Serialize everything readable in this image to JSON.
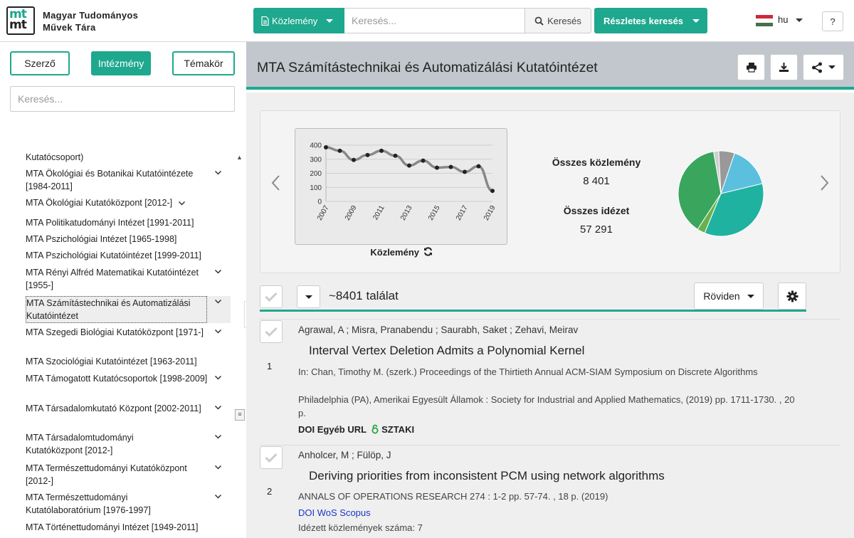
{
  "header": {
    "logo_text_top": "mt",
    "logo_text_bottom": "mt",
    "brand_line1": "Magyar Tudományos",
    "brand_line2": "Művek Tára",
    "type_button": "Közlemény",
    "search_placeholder": "Keresés...",
    "search_button": "Keresés",
    "advanced_button": "Részletes keresés",
    "language": "hu",
    "help": "?"
  },
  "sidebar": {
    "tabs": [
      "Szerző",
      "Intézmény",
      "Témakör"
    ],
    "active_tab": "Intézmény",
    "search_placeholder": "Keresés...",
    "items": [
      {
        "label": "Kutatócsoport)",
        "expandable": false
      },
      {
        "label": "MTA Ökológiai és Botanikai Kutatóintézete [1984-2011]",
        "expandable": true
      },
      {
        "label": "MTA Ökológiai Kutatóközpont [2012-]",
        "expandable": true
      },
      {
        "label": "MTA Politikatudományi Intézet [1991-2011]",
        "expandable": false
      },
      {
        "label": "MTA Pszichológiai Intézet [1965-1998]",
        "expandable": false
      },
      {
        "label": "MTA Pszichológiai Kutatóintézet [1999-2011]",
        "expandable": false
      },
      {
        "label": "MTA Rényi Alfréd Matematikai Kutatóintézet [1955-]",
        "expandable": true
      },
      {
        "label": "MTA Számítástechnikai és Automatizálási Kutatóintézet",
        "expandable": true,
        "selected": true
      },
      {
        "label": "MTA Szegedi Biológiai Kutatóközpont [1971-]",
        "expandable": true
      },
      {
        "label": "MTA Szociológiai Kutatóintézet [1963-2011]",
        "expandable": false
      },
      {
        "label": "MTA Támogatott Kutatócsoportok [1998-2009]",
        "expandable": true
      },
      {
        "label": "MTA Társadalomkutató Központ [2002-2011]",
        "expandable": true
      },
      {
        "label": "MTA Társadalomtudományi Kutatóközpont [2012-]",
        "expandable": true
      },
      {
        "label": "MTA Természettudományi Kutatóközpont [2012-]",
        "expandable": true
      },
      {
        "label": "MTA Természettudományi Kutatólaboratórium [1976-1997]",
        "expandable": true
      },
      {
        "label": "MTA Történettudományi Intézet [1949-2011]",
        "expandable": false
      }
    ]
  },
  "main": {
    "title": "MTA Számítástechnikai és Automatizálási Kutatóintézet",
    "stats": {
      "total_pubs_label": "Összes közlemény",
      "total_pubs": "8 401",
      "total_cites_label": "Összes idézet",
      "total_cites": "57 291"
    },
    "chart_caption": "Közlemény",
    "results_count": "~8401 találat",
    "view_mode": "Röviden"
  },
  "chart_data": [
    {
      "type": "line",
      "x": [
        2007,
        2008,
        2009,
        2010,
        2011,
        2012,
        2013,
        2014,
        2015,
        2016,
        2017,
        2018,
        2019
      ],
      "values": [
        385,
        360,
        295,
        330,
        360,
        325,
        255,
        290,
        240,
        245,
        210,
        250,
        75
      ],
      "x_ticks": [
        "2007",
        "2009",
        "2011",
        "2013",
        "2015",
        "2017",
        "2019"
      ],
      "y_ticks": [
        "0",
        "100",
        "200",
        "300",
        "400"
      ],
      "ylim": [
        0,
        400
      ],
      "grid": true,
      "title": "",
      "xlabel": "",
      "ylabel": ""
    },
    {
      "type": "pie",
      "values": [
        2,
        38,
        3,
        35,
        16,
        6
      ],
      "colors": [
        "#d0d0d0",
        "#3aa55c",
        "#6ab04c",
        "#20b2a0",
        "#5bc0de",
        "#999999"
      ]
    }
  ],
  "results": [
    {
      "num": "1",
      "authors": "Agrawal, A ; Misra, Pranabendu ; Saurabh, Saket ; Zehavi, Meirav",
      "title": "Interval Vertex Deletion Admits a Polynomial Kernel",
      "line1": "In: Chan, Timothy M. (szerk.) Proceedings of the Thirtieth Annual ACM-SIAM Symposium on Discrete Algorithms",
      "line2": "Philadelphia (PA), Amerikai Egyesült Államok : Society for Industrial and Applied Mathematics, (2019) pp. 1711-1730. , 20 p.",
      "links": "DOI Egyéb URL",
      "extra": "SZTAKI"
    },
    {
      "num": "2",
      "authors": "Anholcer, M ; Fülöp, J",
      "title": "Deriving priorities from inconsistent PCM using network algorithms",
      "line1": "ANNALS OF OPERATIONS RESEARCH 274 : 1-2 pp. 57-74. , 18 p. (2019)",
      "links": "DOI WoS Scopus",
      "cites": "Idézett közlemények száma: 7"
    }
  ],
  "colors": {
    "accent": "#1ea88e",
    "titlebar": "#c1c7cc",
    "link": "#1a35c8"
  }
}
